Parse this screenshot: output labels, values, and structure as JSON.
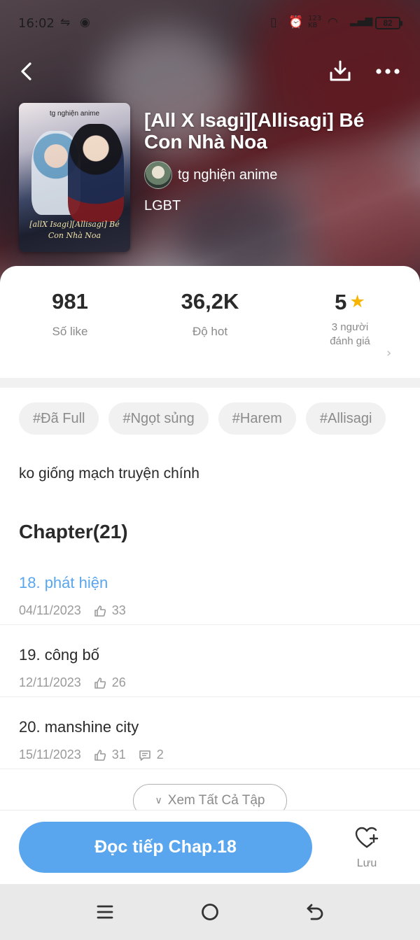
{
  "status_bar": {
    "time": "16:02",
    "battery": "82"
  },
  "book": {
    "title": "[All X Isagi][Allisagi] Bé Con Nhà Noa",
    "author": "tg nghiện anime",
    "genre": "LGBT",
    "cover": {
      "top_text": "tg nghiện anime",
      "title_text": "[allX Isagi][Allisagi] Bé Con Nhà Noa"
    }
  },
  "stats": {
    "likes": {
      "value": "981",
      "label": "Số like"
    },
    "hot": {
      "value": "36,2K",
      "label": "Độ hot"
    },
    "rating": {
      "value": "5",
      "label_line1": "3 người",
      "label_line2": "đánh giá"
    }
  },
  "tags": [
    "#Đã Full",
    "#Ngọt sủng",
    "#Harem",
    "#Allisagi"
  ],
  "description": "ko giống mạch truyện chính",
  "chapters": {
    "header": "Chapter(21)",
    "items": [
      {
        "title": "18. phát hiện",
        "date": "04/11/2023",
        "likes": "33",
        "comments": "",
        "active": true
      },
      {
        "title": "19. công bố",
        "date": "12/11/2023",
        "likes": "26",
        "comments": "",
        "active": false
      },
      {
        "title": "20. manshine city",
        "date": "15/11/2023",
        "likes": "31",
        "comments": "2",
        "active": false
      }
    ],
    "see_all": "Xem Tất Cả Tập"
  },
  "actions": {
    "read_continue": "Đọc tiếp Chap.18",
    "save": "Lưu"
  },
  "colors": {
    "accent": "#5aa6ee",
    "star": "#f7b500",
    "tag_bg": "#f1f1f1"
  },
  "icons": {
    "back": "back-arrow-icon",
    "download": "download-icon",
    "more": "more-dots-icon",
    "star": "star-icon",
    "like": "thumbs-up-icon",
    "comment": "comment-icon",
    "save": "heart-plus-icon",
    "nav_menu": "menu-icon",
    "nav_home": "home-circle-icon",
    "nav_back": "back-return-icon"
  }
}
